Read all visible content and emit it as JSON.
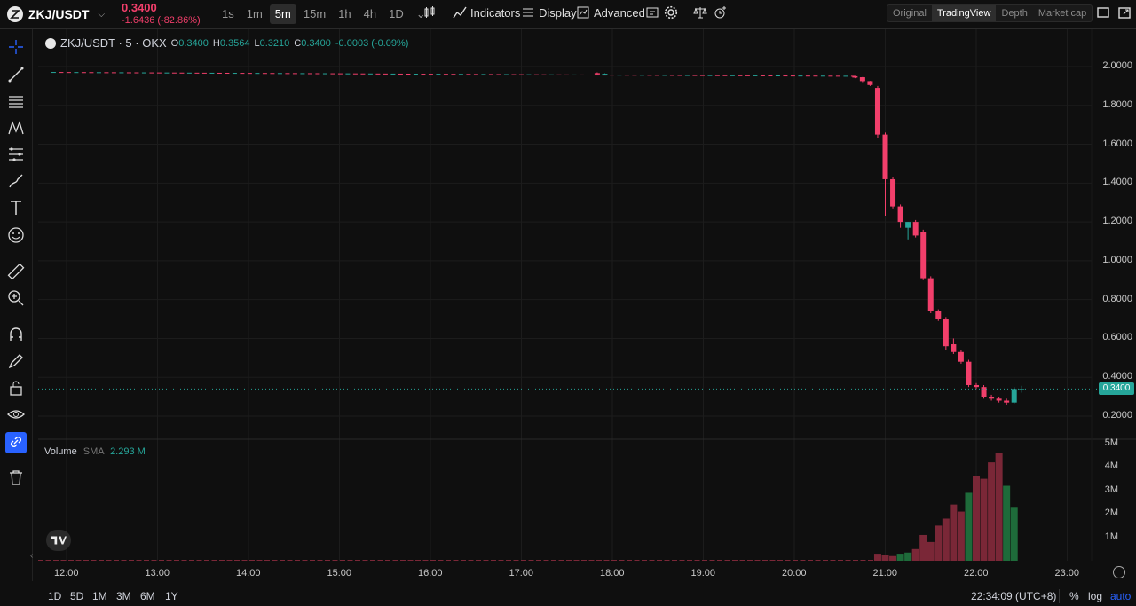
{
  "header": {
    "pair": "ZKJ/USDT",
    "price": "0.3400",
    "change": "-1.6436 (-82.86%)",
    "intervals": [
      "1s",
      "1m",
      "5m",
      "15m",
      "1h",
      "4h",
      "1D"
    ],
    "active_interval": "5m",
    "indicators_label": "Indicators",
    "display_label": "Display",
    "advanced_label": "Advanced",
    "views": [
      "Original",
      "TradingView",
      "Depth",
      "Market cap"
    ],
    "active_view": "TradingView"
  },
  "legend": {
    "symbol": "ZKJ/USDT · 5 · OKX",
    "o_label": "O",
    "o": "0.3400",
    "h_label": "H",
    "h": "0.3564",
    "l_label": "L",
    "l": "0.3210",
    "c_label": "C",
    "c": "0.3400",
    "chg": "-0.0003 (-0.09%)"
  },
  "volume_legend": {
    "label": "Volume",
    "sma_label": "SMA",
    "sma_value": "2.293 M"
  },
  "price_axis": [
    "2.0000",
    "1.8000",
    "1.6000",
    "1.4000",
    "1.2000",
    "1.0000",
    "0.8000",
    "0.6000",
    "0.4000",
    "0.2000"
  ],
  "volume_axis": [
    "5M",
    "4M",
    "3M",
    "2M",
    "1M"
  ],
  "time_axis": [
    "12:00",
    "13:00",
    "14:00",
    "15:00",
    "16:00",
    "17:00",
    "18:00",
    "19:00",
    "20:00",
    "21:00",
    "22:00",
    "23:00"
  ],
  "last_price_tag": "0.3400",
  "footer": {
    "ranges": [
      "1D",
      "5D",
      "1M",
      "3M",
      "6M",
      "1Y"
    ],
    "clock": "22:34:09 (UTC+8)",
    "percent": "%",
    "log": "log",
    "auto": "auto"
  },
  "colors": {
    "up": "#26a69a",
    "down": "#f23f6b",
    "vol_up": "#1e6b3a",
    "vol_down": "#7a2737",
    "background": "#0f0f0f",
    "accent": "#2962ff"
  },
  "chart_data": {
    "type": "candlestick",
    "price_ylim": [
      0.2,
      2.0
    ],
    "volume_ylim": [
      0,
      5
    ],
    "volume_unit": "M",
    "candles": [
      {
        "t": "17:50",
        "o": 1.9663,
        "h": 1.97,
        "l": 1.955,
        "c": 1.96
      },
      {
        "t": "17:55",
        "o": 1.958,
        "h": 1.965,
        "l": 1.955,
        "c": 1.963
      },
      {
        "t": "20:40",
        "o": 1.95,
        "h": 1.952,
        "l": 1.94,
        "c": 1.945
      },
      {
        "t": "20:45",
        "o": 1.945,
        "h": 1.946,
        "l": 1.92,
        "c": 1.925
      },
      {
        "t": "20:50",
        "o": 1.925,
        "h": 1.926,
        "l": 1.9,
        "c": 1.905
      },
      {
        "t": "20:55",
        "o": 1.89,
        "h": 1.9,
        "l": 1.63,
        "c": 1.65
      },
      {
        "t": "21:00",
        "o": 1.65,
        "h": 1.66,
        "l": 1.23,
        "c": 1.42
      },
      {
        "t": "21:05",
        "o": 1.42,
        "h": 1.43,
        "l": 1.27,
        "c": 1.28
      },
      {
        "t": "21:10",
        "o": 1.28,
        "h": 1.29,
        "l": 1.17,
        "c": 1.2
      },
      {
        "t": "21:15",
        "o": 1.17,
        "h": 1.2,
        "l": 1.11,
        "c": 1.2
      },
      {
        "t": "21:20",
        "o": 1.2,
        "h": 1.21,
        "l": 1.12,
        "c": 1.13
      },
      {
        "t": "21:25",
        "o": 1.15,
        "h": 1.16,
        "l": 0.9,
        "c": 0.91
      },
      {
        "t": "21:30",
        "o": 0.91,
        "h": 0.92,
        "l": 0.73,
        "c": 0.74
      },
      {
        "t": "21:35",
        "o": 0.74,
        "h": 0.75,
        "l": 0.69,
        "c": 0.7
      },
      {
        "t": "21:40",
        "o": 0.7,
        "h": 0.71,
        "l": 0.54,
        "c": 0.56
      },
      {
        "t": "21:45",
        "o": 0.57,
        "h": 0.6,
        "l": 0.52,
        "c": 0.53
      },
      {
        "t": "21:50",
        "o": 0.53,
        "h": 0.54,
        "l": 0.47,
        "c": 0.48
      },
      {
        "t": "21:55",
        "o": 0.48,
        "h": 0.49,
        "l": 0.35,
        "c": 0.36
      },
      {
        "t": "22:00",
        "o": 0.36,
        "h": 0.37,
        "l": 0.34,
        "c": 0.35
      },
      {
        "t": "22:05",
        "o": 0.35,
        "h": 0.36,
        "l": 0.29,
        "c": 0.3
      },
      {
        "t": "22:10",
        "o": 0.3,
        "h": 0.31,
        "l": 0.28,
        "c": 0.29
      },
      {
        "t": "22:15",
        "o": 0.29,
        "h": 0.3,
        "l": 0.27,
        "c": 0.28
      },
      {
        "t": "22:20",
        "o": 0.28,
        "h": 0.29,
        "l": 0.255,
        "c": 0.27
      },
      {
        "t": "22:25",
        "o": 0.27,
        "h": 0.35,
        "l": 0.265,
        "c": 0.34
      },
      {
        "t": "22:30",
        "o": 0.34,
        "h": 0.3564,
        "l": 0.321,
        "c": 0.34
      }
    ],
    "flat_segment": {
      "from": "11:50",
      "to": "20:40",
      "price_start": 1.97,
      "price_end": 1.95
    },
    "volumes": [
      {
        "t": "20:55",
        "v": 0.3,
        "dir": "down"
      },
      {
        "t": "21:00",
        "v": 0.25,
        "dir": "down"
      },
      {
        "t": "21:05",
        "v": 0.2,
        "dir": "down"
      },
      {
        "t": "21:10",
        "v": 0.3,
        "dir": "up"
      },
      {
        "t": "21:15",
        "v": 0.35,
        "dir": "up"
      },
      {
        "t": "21:20",
        "v": 0.5,
        "dir": "down"
      },
      {
        "t": "21:25",
        "v": 1.1,
        "dir": "down"
      },
      {
        "t": "21:30",
        "v": 0.8,
        "dir": "down"
      },
      {
        "t": "21:35",
        "v": 1.5,
        "dir": "down"
      },
      {
        "t": "21:40",
        "v": 1.8,
        "dir": "down"
      },
      {
        "t": "21:45",
        "v": 2.4,
        "dir": "down"
      },
      {
        "t": "21:50",
        "v": 2.1,
        "dir": "down"
      },
      {
        "t": "21:55",
        "v": 2.9,
        "dir": "up"
      },
      {
        "t": "22:00",
        "v": 3.6,
        "dir": "down"
      },
      {
        "t": "22:05",
        "v": 3.5,
        "dir": "down"
      },
      {
        "t": "22:10",
        "v": 4.2,
        "dir": "down"
      },
      {
        "t": "22:15",
        "v": 4.6,
        "dir": "down"
      },
      {
        "t": "22:20",
        "v": 3.2,
        "dir": "up"
      },
      {
        "t": "22:25",
        "v": 2.3,
        "dir": "up"
      }
    ]
  }
}
